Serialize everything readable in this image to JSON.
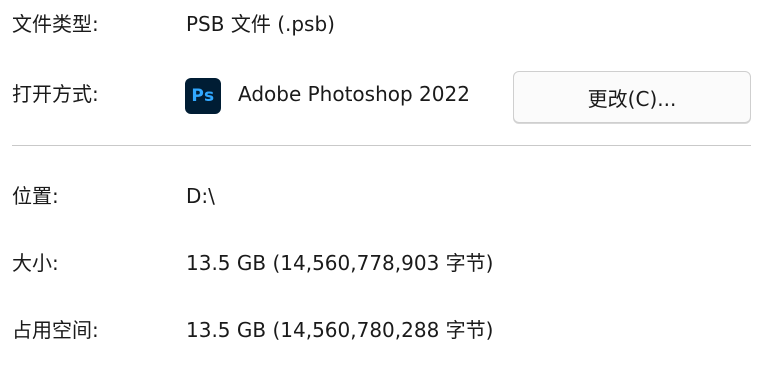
{
  "properties": {
    "file_type": {
      "label": "文件类型:",
      "value": "PSB 文件 (.psb)"
    },
    "open_with": {
      "label": "打开方式:",
      "app_icon": "photoshop-icon",
      "app_icon_text": "Ps",
      "app_name": "Adobe Photoshop 2022",
      "change_button_label": "更改(C)..."
    },
    "location": {
      "label": "位置:",
      "value": "D:\\"
    },
    "size": {
      "label": "大小:",
      "value": "13.5 GB (14,560,778,903 字节)"
    },
    "size_on_disk": {
      "label": "占用空间:",
      "value": "13.5 GB (14,560,780,288 字节)"
    }
  },
  "colors": {
    "photoshop_icon_bg": "#001d34",
    "photoshop_icon_fg": "#31a8ff",
    "divider": "#c9c9c9"
  }
}
